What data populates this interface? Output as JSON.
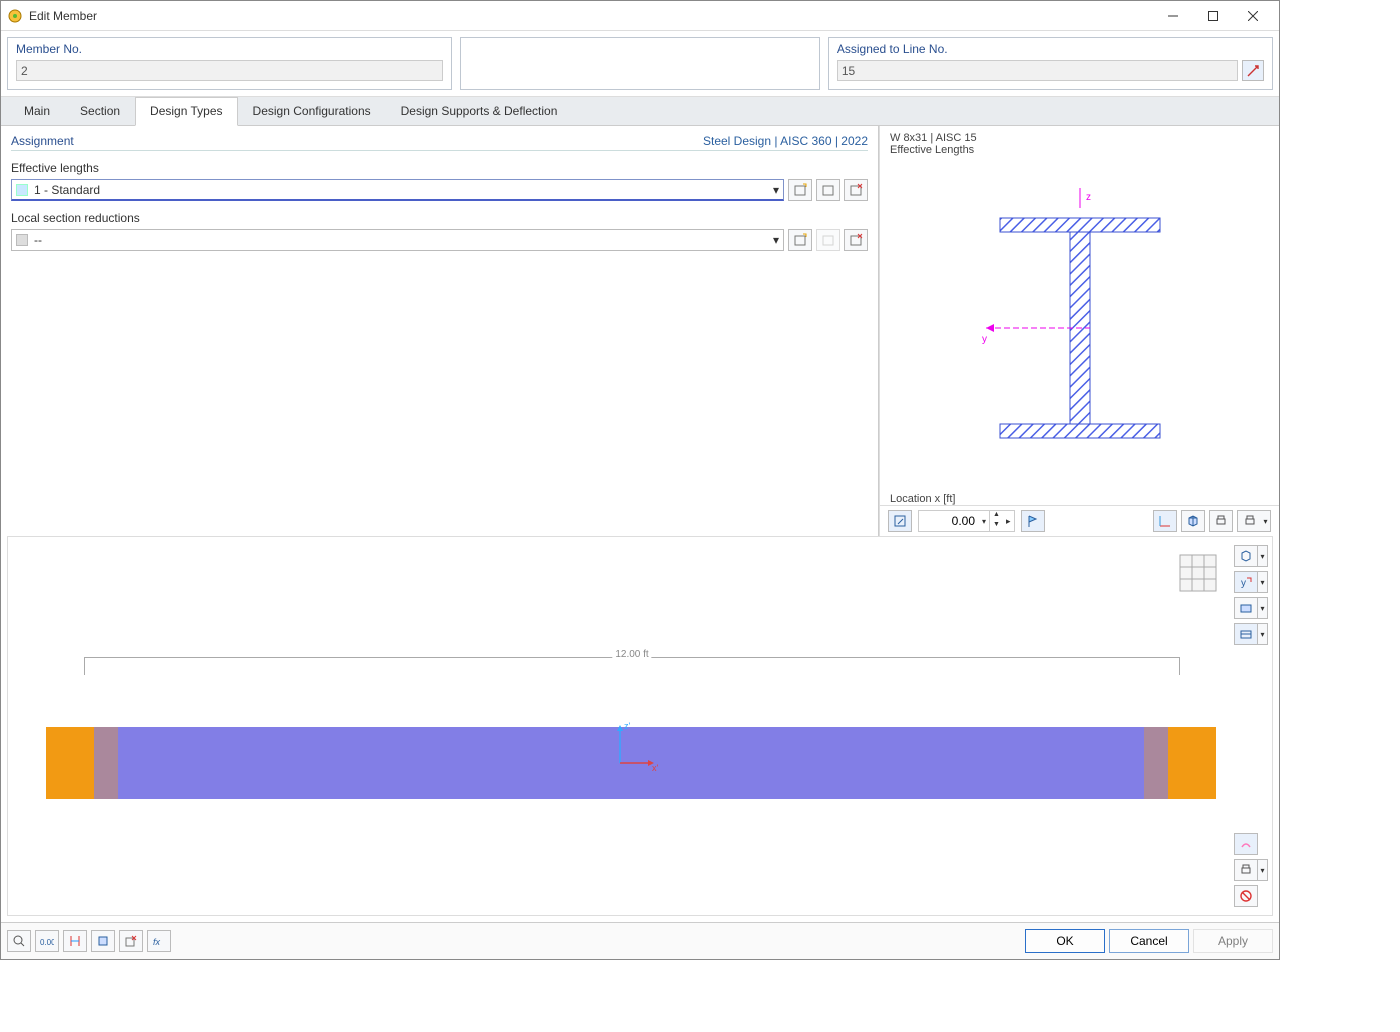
{
  "window": {
    "title": "Edit Member"
  },
  "header": {
    "member_no_label": "Member No.",
    "member_no_value": "2",
    "assigned_label": "Assigned to Line No.",
    "assigned_value": "15"
  },
  "tabs": {
    "main": "Main",
    "section": "Section",
    "design_types": "Design Types",
    "design_config": "Design Configurations",
    "supports": "Design Supports & Deflection"
  },
  "assignment": {
    "label": "Assignment",
    "design_link": "Steel Design | AISC 360 | 2022",
    "eff_lengths_label": "Effective lengths",
    "eff_lengths_value": "1 - Standard",
    "local_section_label": "Local section reductions",
    "local_section_value": "--"
  },
  "preview": {
    "section_name": "W 8x31 | AISC 15",
    "section_caption": "Effective Lengths",
    "axis_z": "z",
    "axis_y": "y",
    "location_label": "Location x [ft]",
    "location_value": "0.00"
  },
  "member_view": {
    "length_label": "12.00 ft",
    "axis_z": "z'",
    "axis_x": "x'"
  },
  "buttons": {
    "ok": "OK",
    "cancel": "Cancel",
    "apply": "Apply"
  }
}
